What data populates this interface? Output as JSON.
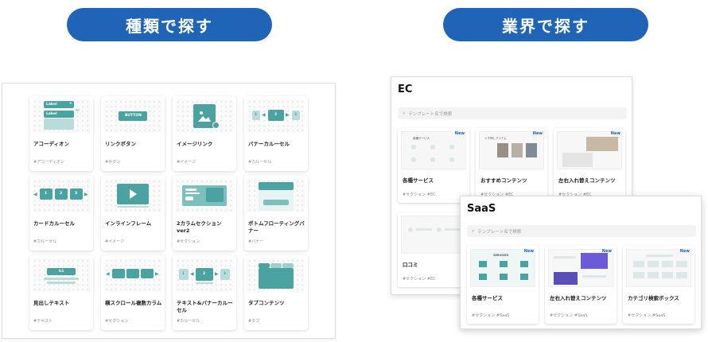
{
  "pills": {
    "type": "種類で探す",
    "industry": "業界で探す"
  },
  "components": [
    {
      "title": "アコーディオン",
      "tag": "#アコーディオン",
      "thumb": {
        "label1": "Label",
        "label2": "Label"
      }
    },
    {
      "title": "リンクボタン",
      "tag": "#ボタン",
      "thumb": {
        "button": "BUTTON"
      }
    },
    {
      "title": "イメージリンク",
      "tag": "#イメージ"
    },
    {
      "title": "バナーカルーセル",
      "tag": "#カルーセル",
      "thumb": {
        "n1": "1",
        "n2": "2",
        "n3": "3"
      }
    },
    {
      "title": "カードカルーセル",
      "tag": "#カルーセル",
      "thumb": {
        "n1": "1",
        "n2": "2",
        "n3": "3"
      }
    },
    {
      "title": "インラインフレーム",
      "tag": "#イメージ"
    },
    {
      "title": "2カラムセクション ver2",
      "tag": "#セクション"
    },
    {
      "title": "ボトムフローティングバナー",
      "tag": "#バナー"
    },
    {
      "title": "見出しテキスト",
      "tag": "#テキスト",
      "thumb": {
        "h": "h1"
      }
    },
    {
      "title": "横スクロール複数カラム",
      "tag": "#セクション"
    },
    {
      "title": "テキスト&バナーカルーセル",
      "tag": "#カルーセル",
      "thumb": {
        "n1": "1",
        "n2": "2",
        "n3": "3"
      }
    },
    {
      "title": "タブコンテンツ",
      "tag": "#タブ"
    }
  ],
  "ec": {
    "title": "EC",
    "search_placeholder": "テンプレート名で検索",
    "templates": [
      {
        "title": "各種サービス",
        "tags": "#セクション  #EC",
        "new": "New"
      },
      {
        "title": "おすすめコンテンツ",
        "tags": "#セクション  #EC",
        "new": "New"
      },
      {
        "title": "左右入れ替えコンテンツ",
        "tags": "#セクション  #EC",
        "new": "New"
      },
      {
        "title": "口コミ",
        "tags": "#セクション  #EC",
        "new": ""
      }
    ]
  },
  "saas": {
    "title": "SaaS",
    "search_placeholder": "テンプレート名で検索",
    "templates": [
      {
        "title": "各種サービス",
        "tags": "#セクション  #SaaS",
        "new": "New",
        "thumb_text": "SERVICES"
      },
      {
        "title": "左右入れ替えコンテンツ",
        "tags": "#セクション  #SaaS",
        "new": "New"
      },
      {
        "title": "カテゴリ検索ボックス",
        "tags": "#セクション  #SaaS",
        "new": "New"
      }
    ]
  },
  "colors": {
    "accent": "#1f64b7",
    "teal": "#4aa3a1"
  },
  "icons": {
    "search": "search-icon"
  }
}
